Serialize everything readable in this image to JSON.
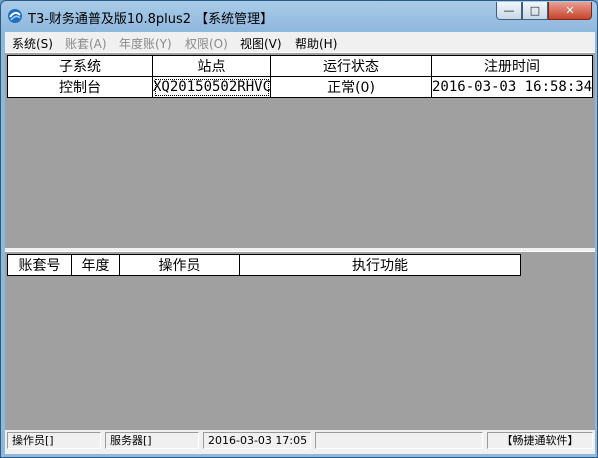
{
  "window": {
    "title": "T3-财务通普及版10.8plus2 【系统管理】",
    "minimize": "—",
    "maximize": "□",
    "close": "✕"
  },
  "menu": [
    {
      "label": "系统(S)",
      "enabled": true
    },
    {
      "label": "账套(A)",
      "enabled": false
    },
    {
      "label": "年度账(Y)",
      "enabled": false
    },
    {
      "label": "权限(O)",
      "enabled": false
    },
    {
      "label": "视图(V)",
      "enabled": true
    },
    {
      "label": "帮助(H)",
      "enabled": true
    }
  ],
  "subsystem_table": {
    "headers": [
      "子系统",
      "站点",
      "运行状态",
      "注册时间"
    ],
    "rows": [
      [
        "控制台",
        "XQ20150502RHVC",
        "正常(0)",
        "2016-03-03 16:58:34"
      ]
    ]
  },
  "task_table": {
    "headers": [
      "账套号",
      "年度",
      "操作员",
      "执行功能"
    ]
  },
  "statusbar": {
    "operator": "操作员[]",
    "server": "服务器[]",
    "datetime": "2016-03-03 17:05",
    "empty": "",
    "brand": "【畅捷通软件】"
  },
  "colors": {
    "panel_bg": "#a0a0a0",
    "chrome": "#f0f0f0"
  }
}
